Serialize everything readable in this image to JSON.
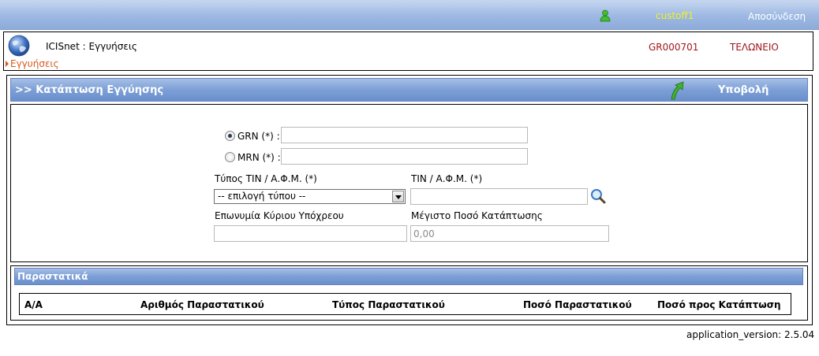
{
  "topbar": {
    "user_name": "custoff1",
    "logout_label": "Αποσύνδεση"
  },
  "header": {
    "app_title": "ICISnet : Εγγυήσεις",
    "gr_code": "GR000701",
    "office": "ΤΕΛΩΝΕΙΟ",
    "breadcrumb": "Εγγυήσεις"
  },
  "panel": {
    "title": ">> Κατάπτωση Εγγύησης",
    "submit_label": "Υποβολή"
  },
  "form": {
    "grn_label": "GRN (*) :",
    "grn_checked": true,
    "grn_value": "",
    "mrn_label": "MRN (*) :",
    "mrn_checked": false,
    "mrn_value": "",
    "tin_type_label": "Τύπος TIN / Α.Φ.Μ. (*)",
    "tin_type_selected": "-- επιλογή τύπου --",
    "tin_label": "TIN / Α.Φ.Μ. (*)",
    "tin_value": "",
    "principal_name_label": "Επωνυμία Κύριου Υπόχρεου",
    "principal_name_value": "",
    "max_amount_label": "Μέγιστο Ποσό Κατάπτωσης",
    "max_amount_value": "0,00"
  },
  "documents": {
    "title": "Παραστατικά",
    "columns": [
      "Α/Α",
      "Αριθμός Παραστατικού",
      "Τύπος Παραστατικού",
      "Ποσό Παραστατικού",
      "Ποσό προς Κατάπτωση"
    ]
  },
  "footer": {
    "version": "application_version: 2.5.04"
  },
  "colors": {
    "bar_blue": "#7c9fd6",
    "accent_red": "#a0161b",
    "breadcrumb_orange": "#d45a1e",
    "user_yellow": "#f2f21e"
  }
}
